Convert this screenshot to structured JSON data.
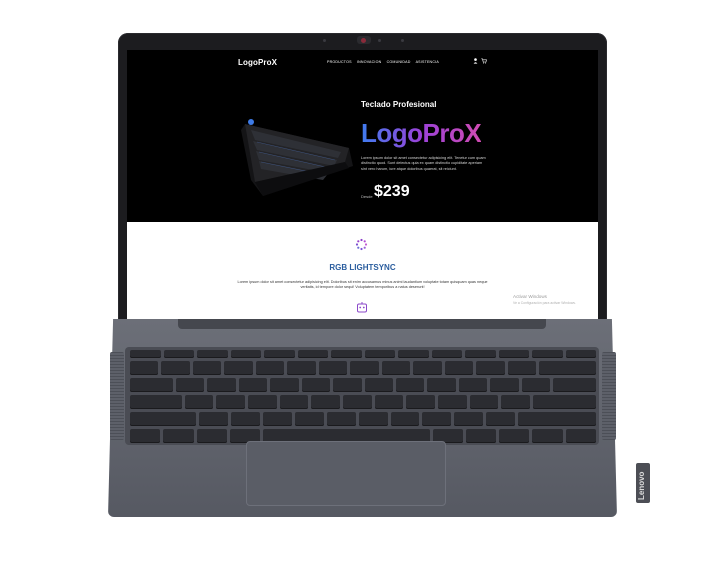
{
  "site": {
    "logo": "LogoProX",
    "nav": [
      "PRODUCTOS",
      "INNOVACION",
      "COMUNIDAD",
      "ASISTENCIA"
    ],
    "nav_icons": [
      "user-icon",
      "cart-icon"
    ],
    "hero": {
      "heading": "Teclado Profesional",
      "brand": "LogoProX",
      "description": "Lorem ipsum dolor sit amet consectetur adipisicing elit. Tenetur cum quam distinctio quod. Sunt delectus quia ex quam distinctio cupiditate aperiam sint vero harum, iure atque doloribus quaerat, sit reiciunt.",
      "price_label": "Desde",
      "price": "$239"
    },
    "feature": {
      "title": "RGB LIGHTSYNC",
      "description": "Lorem ipsum dolor sit amet consectetur adipisicing elit. Doloribus sit enim accusamus minus animi laudantium voluptate totam quisquam quas neque veritatis, id tempore dolor sequi! Voluptatem temporibus a natus deserunt!"
    },
    "windows_watermark": {
      "line1": "Activar Windows",
      "line2": "Ve a Configuración para activar Windows."
    }
  },
  "laptop": {
    "brand": "Lenovo",
    "colors": {
      "chassis": "#5f626b",
      "bezel": "#1c1c1f",
      "keys": "#2b2c31"
    }
  }
}
